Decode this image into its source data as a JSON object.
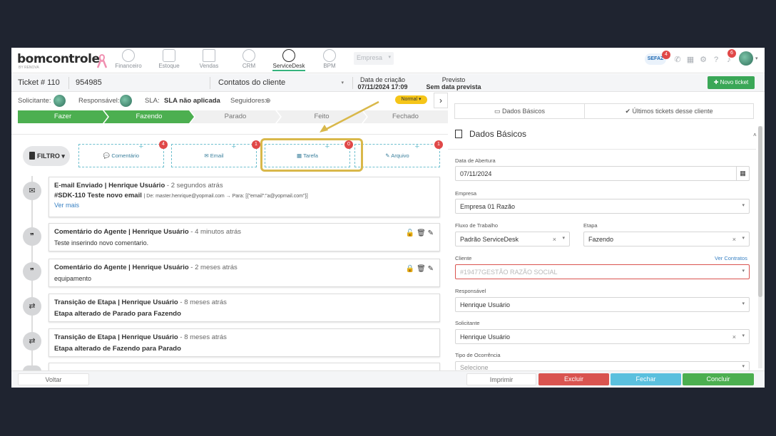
{
  "topnav": {
    "logo": "bomcontrole",
    "logo_sub": "BY RENOVA",
    "items": [
      {
        "label": "Financeiro",
        "icon": "dollar-icon"
      },
      {
        "label": "Estoque",
        "icon": "box-icon"
      },
      {
        "label": "Vendas",
        "icon": "cart-icon"
      },
      {
        "label": "CRM",
        "icon": "crm-icon"
      },
      {
        "label": "ServiceDesk",
        "icon": "headset-icon"
      },
      {
        "label": "BPM",
        "icon": "bpm-icon"
      }
    ],
    "active": "ServiceDesk",
    "empresa_placeholder": "Empresa",
    "sefaz_label": "SEFAZ",
    "sefaz_badge": "4",
    "bell_badge": "6"
  },
  "header": {
    "ticket_label": "Ticket # 110",
    "ticket_code": "954985",
    "contact_select": "Contatos do cliente",
    "created_label": "Data de criação",
    "created_value": "07/11/2024 17:09",
    "previsto_label": "Previsto",
    "previsto_value": "Sem data prevista",
    "new_ticket": "Novo ticket"
  },
  "people": {
    "solicitante": "Solicitante:",
    "responsavel": "Responsável:",
    "sla_label": "SLA:",
    "sla_value": "SLA não aplicada",
    "seguidores": "Seguidores:",
    "priority": "Normal"
  },
  "stages": [
    {
      "label": "Fazer",
      "done": true
    },
    {
      "label": "Fazendo",
      "done": true
    },
    {
      "label": "Parado",
      "done": false
    },
    {
      "label": "Feito",
      "done": false
    },
    {
      "label": "Fechado",
      "done": false
    }
  ],
  "actions": {
    "filtro": "FILTRO",
    "items": [
      {
        "label": "Comentário",
        "badge": "4"
      },
      {
        "label": "Email",
        "badge": "1"
      },
      {
        "label": "Tarefa",
        "badge": "0"
      },
      {
        "label": "Arquivo",
        "badge": "1"
      }
    ]
  },
  "timeline": [
    {
      "type": "E-mail Enviado",
      "user": "Henrique Usuário",
      "time": "2 segundos atrás",
      "line2_bold": "#SDK-110 Teste novo email",
      "line2_small": "| De: master.henrique@yopmail.com → Para: [{\"email\":\"a@yopmail.com\"}]",
      "more": "Ver mais",
      "icon": "email-icon"
    },
    {
      "type": "Comentário do Agente",
      "user": "Henrique Usuário",
      "time": "4 minutos atrás",
      "body": "Teste inserindo novo comentario.",
      "icon": "comment-icon",
      "locked": false
    },
    {
      "type": "Comentário do Agente",
      "user": "Henrique Usuário",
      "time": "2 meses atrás",
      "body": "equipamento",
      "icon": "comment-icon",
      "locked": true
    },
    {
      "type": "Transição de Etapa",
      "user": "Henrique Usuário",
      "time": "8 meses atrás",
      "body": "Etapa alterado de Parado para Fazendo",
      "icon": "transfer-icon"
    },
    {
      "type": "Transição de Etapa",
      "user": "Henrique Usuário",
      "time": "8 meses atrás",
      "body": "Etapa alterado de Fazendo para Parado",
      "icon": "transfer-icon"
    }
  ],
  "right": {
    "tab_dados": "Dados Básicos",
    "tab_ultimos": "Últimos tickets desse cliente",
    "section_title": "Dados Básicos",
    "fields": {
      "abertura_label": "Data de Abertura",
      "abertura_value": "07/11/2024",
      "empresa_label": "Empresa",
      "empresa_value": "Empresa 01 Razão",
      "fluxo_label": "Fluxo de Trabalho",
      "fluxo_value": "Padrão ServiceDesk",
      "etapa_label": "Etapa",
      "etapa_value": "Fazendo",
      "cliente_label": "Cliente",
      "ver_contratos": "Ver Contratos",
      "cliente_value": "#19477GESTÃO RAZÃO SOCIAL",
      "responsavel_label": "Responsável",
      "responsavel_value": "Henrique Usuário",
      "solicitante_label": "Solicitante",
      "solicitante_value": "Henrique Usuário",
      "ocorrencia_label": "Tipo de Ocorrência",
      "ocorrencia_placeholder": "Selecione"
    }
  },
  "footer": {
    "voltar": "Voltar",
    "imprimir": "Imprimir",
    "excluir": "Excluir",
    "fechar": "Fechar",
    "concluir": "Concluir"
  },
  "colors": {
    "accent_green": "#4caf50",
    "danger": "#d9534f",
    "info": "#5bc0de",
    "highlight": "#d9b84a",
    "priority": "#f5c518"
  }
}
